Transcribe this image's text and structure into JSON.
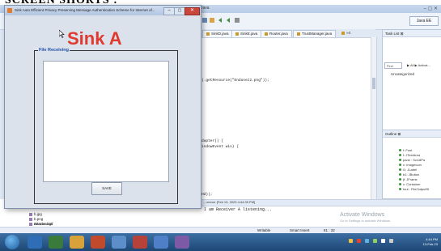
{
  "top_caption": "SCREEN SHORTS :",
  "eclipse": {
    "title": "Java",
    "window_controls": "– ▢ ✕",
    "editor_tabs": [
      "SinkD.java",
      "SinkE.java",
      "Router.java",
      "TrustManager.java",
      "»4"
    ],
    "code_lines": [
      ").getResource(\"Endusez2.png\"));",
      "dapter() {",
      "indowEvent win) {",
      "Hd));"
    ],
    "perspective_button": "Java EE",
    "task_list_title": "Task List ⊠",
    "find_placeholder": "Find",
    "all_activate": "▶ All ▶ Activat...",
    "uncategorized": "Uncategorized",
    "outline_title": "Outline ⊠",
    "outline_items": [
      "f: Font",
      "f: JTextArea",
      "pane : ScrollPa",
      "c: ImageIcon",
      "l1: JLabel",
      "b1: JButton",
      "jf: JFrame",
      "c: Container",
      "fout : FileOutputSt"
    ],
    "console_header": "...eerver [Feb 13, 2023 4:44:39 PM]",
    "console_output": "I am Receiver A listening...",
    "explorer_items": [
      "Attacked.gif",
      "b.jpg",
      "b.png",
      "Banner.ans"
    ],
    "status_writable": "Writable",
    "status_insert": "Smart Insert",
    "status_position": "81 : 32",
    "activate_line1": "Activate Windows",
    "activate_line2": "Go to Settings to activate Windows.",
    "clock_time": "4:44 PM",
    "clock_date": "13-Feb-23"
  },
  "dialog": {
    "title": "Sink Auto Efficient Privacy Preserving Message Authentication Scheme for Internet of...",
    "heading": "Sink A",
    "group_label": "File Receiving",
    "text_area_value": "",
    "save_label": "SAVE",
    "minimize": "–",
    "maximize": "▢",
    "close": "✕"
  },
  "icons": {
    "cursor": "pointer-cursor-icon",
    "start": "windows-start-icon"
  },
  "colors": {
    "heading_red": "#e03a2e",
    "group_label_blue": "#1f4fa8",
    "taskbar": "#2a5a8c"
  }
}
